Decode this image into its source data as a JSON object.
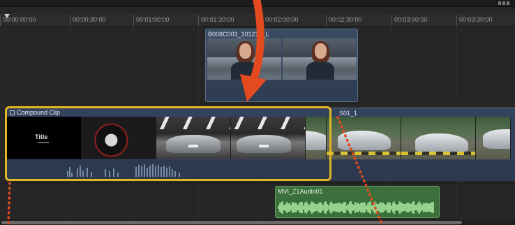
{
  "toolbar": {
    "zoom_icon": "timeline-zoom-icon"
  },
  "ruler": {
    "timecodes": [
      "00:00:00:00",
      "00:00:30:00",
      "00:01:00:00",
      "00:01:30:00",
      "00:02:00:00",
      "00:02:30:00",
      "00:03:00:00",
      "00:03:30:00"
    ]
  },
  "connected_clip": {
    "name": "B008C003_101217_L"
  },
  "storyline": {
    "clip_name": "S01_1",
    "title_frame_text": "Title"
  },
  "compound_clip": {
    "label": "Compound Clip",
    "highlight_color": "#e2b622"
  },
  "audio_clip": {
    "name": "MVI_Z1Audio01",
    "color": "#3b6f3b"
  },
  "annotation": {
    "arrow_color": "#e34a1f",
    "dotted_line_color": "#e34a1f"
  },
  "colors": {
    "timeline_bg": "#262626",
    "video_clip": "#33435d",
    "audio_clip": "#3b6f3b",
    "compound_highlight": "#e2b622"
  }
}
